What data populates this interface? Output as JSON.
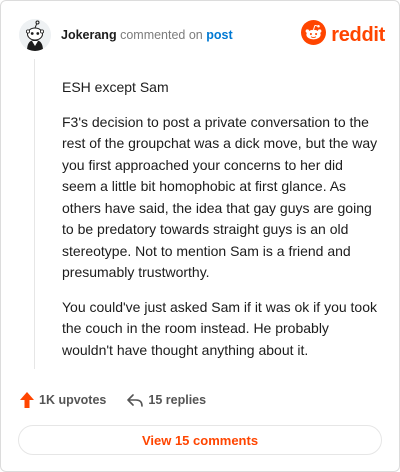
{
  "header": {
    "username": "Jokerang",
    "action_text": "commented on",
    "post_link_label": "post",
    "logo_text": "reddit",
    "avatar_icon": "snoo-avatar-icon",
    "logo_icon": "reddit-alien-icon"
  },
  "comment": {
    "paragraphs": [
      "ESH except Sam",
      "F3's decision to post a private conversation to the rest of the groupchat was a dick move, but the way you first approached your concerns to her did seem a little bit homophobic at first glance. As others have said, the idea that gay guys are going to be predatory towards straight guys is an old stereotype. Not to mention Sam is a friend and presumably trustworthy.",
      "You could've just asked Sam if it was ok if you took the couch in the room instead. He probably wouldn't have thought anything about it."
    ]
  },
  "actions": {
    "upvotes_label": "1K upvotes",
    "replies_label": "15 replies",
    "upvote_icon": "upvote-arrow-icon",
    "reply_icon": "reply-arrow-icon"
  },
  "footer": {
    "view_comments_label": "View 15 comments"
  },
  "colors": {
    "brand": "#ff4500",
    "link": "#0079d3",
    "text": "#1c1c1c",
    "muted": "#7c7c7c"
  }
}
